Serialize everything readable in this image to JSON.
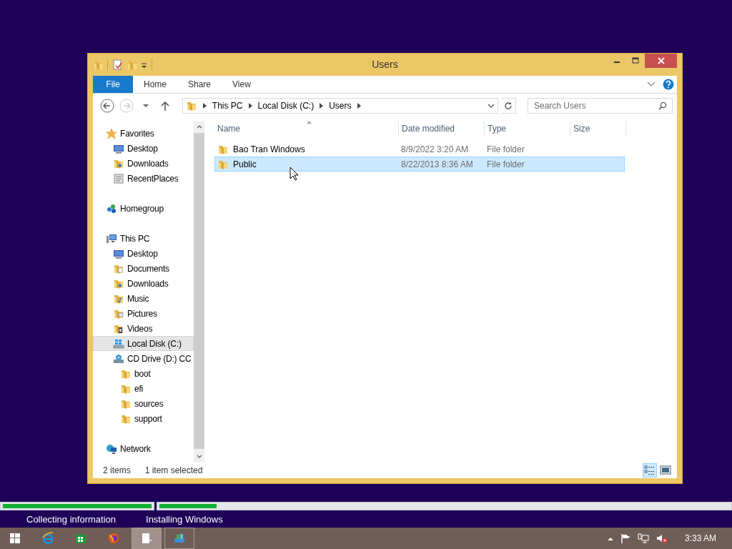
{
  "window": {
    "title": "Users"
  },
  "ribbon": {
    "tabs": [
      {
        "label": "File",
        "kind": "file",
        "selected": false
      },
      {
        "label": "Home",
        "kind": "tab",
        "selected": false
      },
      {
        "label": "Share",
        "kind": "tab",
        "selected": false
      },
      {
        "label": "View",
        "kind": "tab",
        "selected": false
      }
    ]
  },
  "address_bar": {
    "crumbs": [
      "This PC",
      "Local Disk (C:)",
      "Users"
    ]
  },
  "search": {
    "placeholder": "Search Users"
  },
  "nav_pane": {
    "items": [
      {
        "label": "Favorites",
        "kind": "star",
        "selected": false,
        "children": [
          {
            "label": "Desktop",
            "kind": "desktop",
            "selected": false
          },
          {
            "label": "Downloads",
            "kind": "downloads",
            "selected": false
          },
          {
            "label": "RecentPlaces",
            "kind": "recent",
            "selected": false
          }
        ]
      },
      {
        "label": "Homegroup",
        "kind": "homegroup",
        "selected": false
      },
      {
        "label": "This PC",
        "kind": "pc",
        "selected": false,
        "children": [
          {
            "label": "Desktop",
            "kind": "desktop",
            "selected": false
          },
          {
            "label": "Documents",
            "kind": "documents",
            "selected": false
          },
          {
            "label": "Downloads",
            "kind": "downloads",
            "selected": false
          },
          {
            "label": "Music",
            "kind": "music",
            "selected": false
          },
          {
            "label": "Pictures",
            "kind": "pictures",
            "selected": false
          },
          {
            "label": "Videos",
            "kind": "videos",
            "selected": false
          },
          {
            "label": "Local Disk (C:)",
            "kind": "disk",
            "selected": true
          },
          {
            "label": "CD Drive (D:) CC",
            "kind": "cd",
            "selected": false,
            "children": [
              {
                "label": "boot",
                "kind": "folder",
                "selected": false
              },
              {
                "label": "efi",
                "kind": "folder",
                "selected": false
              },
              {
                "label": "sources",
                "kind": "folder",
                "selected": false
              },
              {
                "label": "support",
                "kind": "folder",
                "selected": false
              }
            ]
          }
        ]
      },
      {
        "label": "Network",
        "kind": "network",
        "selected": false
      }
    ]
  },
  "file_list": {
    "columns": [
      {
        "label": "Name",
        "sorted": true
      },
      {
        "label": "Date modified",
        "sorted": false
      },
      {
        "label": "Type",
        "sorted": false
      },
      {
        "label": "Size",
        "sorted": false
      }
    ],
    "rows": [
      {
        "name": "Bao Tran Windows",
        "date": "8/9/2022 3:20 AM",
        "type": "File folder",
        "selected": false
      },
      {
        "name": "Public",
        "date": "8/22/2013 8:36 AM",
        "type": "File folder",
        "selected": true
      }
    ]
  },
  "status_bar": {
    "item_count": "2 items",
    "selection": "1 item selected",
    "views": [
      {
        "kind": "details",
        "selected": true
      },
      {
        "kind": "large_icons",
        "selected": false
      }
    ]
  },
  "setup": {
    "progress": [
      {
        "level": 1
      },
      {
        "level": 0.1
      }
    ],
    "steps": [
      {
        "label": "Collecting information"
      },
      {
        "label": "Installing Windows"
      }
    ]
  },
  "taskbar": {
    "apps": [
      {
        "kind": "start",
        "open": false,
        "selected": false
      },
      {
        "kind": "browser",
        "open": false,
        "selected": false
      },
      {
        "kind": "store",
        "open": false,
        "selected": false
      },
      {
        "kind": "firefox",
        "open": false,
        "selected": false
      },
      {
        "kind": "explorer",
        "open": true,
        "selected": true
      },
      {
        "kind": "setup",
        "open": true,
        "selected": false
      }
    ],
    "clock": "3:33 AM"
  }
}
